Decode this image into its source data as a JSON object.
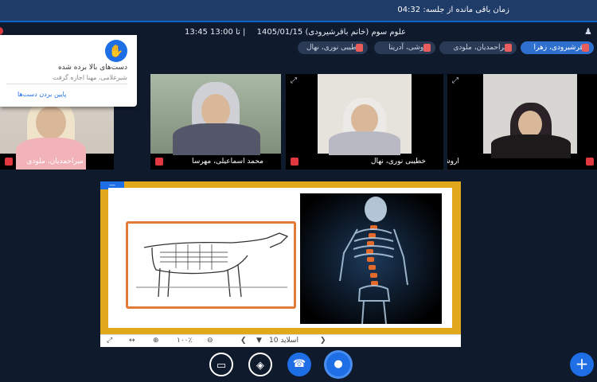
{
  "topbar": {
    "timer_text": "زمان باقی مانده از جلسه: 04:32"
  },
  "session": {
    "title": "علوم سوم (خانم باقرشیرودی) 1405/01/15",
    "time": "13:45 تا 13:00 |"
  },
  "chips": [
    {
      "label": "باقرشیرودی، زهرا",
      "active": true
    },
    {
      "label": "میراحمدیان، ملودی",
      "active": false
    },
    {
      "label": "اروشی، آدرینا",
      "active": false
    },
    {
      "label": "خطیبی نوری، نهال",
      "active": false
    }
  ],
  "videos": [
    {
      "name": "میراحمدیان، ملودی"
    },
    {
      "name": "محمد اسماعیلی، مهرسا"
    },
    {
      "name": "خطیبی نوری، نهال"
    },
    {
      "name": "اروشی، آدرینا"
    }
  ],
  "popup": {
    "heading": "دست‌های بالا برده شده",
    "names": "شیرغلامی، مهنا اجازه گرفت",
    "lower_link": "پایین بردن دست‌ها"
  },
  "slidebar": {
    "slide_label": "اسلاید 10",
    "zoom": "۱۰۰٪"
  },
  "icons": {
    "users": "users-icon",
    "hand": "hand-icon",
    "expand": "expand-icon",
    "mic": "mic-icon",
    "phone": "phone-icon",
    "camera_off": "camera-off-icon",
    "screen_share_off": "screen-share-off-icon",
    "plus": "plus-icon"
  },
  "colors": {
    "topbar": "#1f3b67",
    "accent": "#1e6ee6",
    "frame": "#e0a81a",
    "bg": "#0f1b2d"
  }
}
